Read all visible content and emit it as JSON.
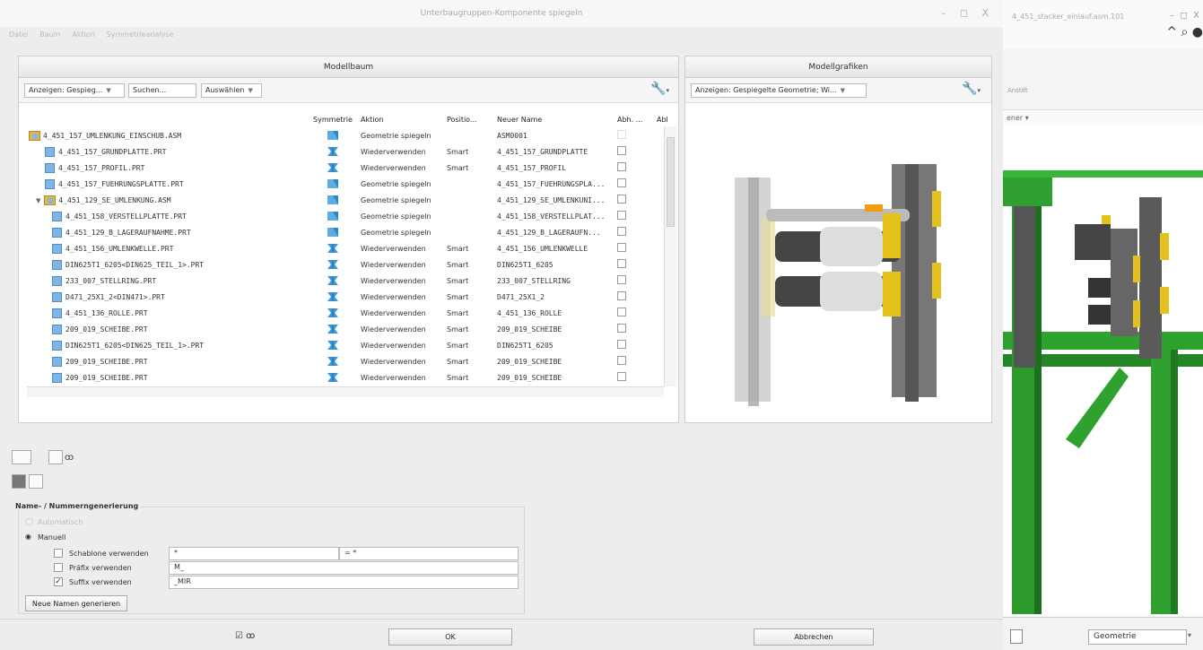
{
  "dialog": {
    "title": "Unterbaugruppen-Komponente spiegeln",
    "window_controls": "– ◻ X",
    "menu": [
      "Datei",
      "Baum",
      "Aktion",
      "Symmetrieanalyse"
    ]
  },
  "modellbaum": {
    "title": "Modellbaum",
    "show_combo": "Anzeigen: Gespieg...",
    "search_placeholder": "Suchen...",
    "select_combo": "Auswählen",
    "columns": [
      "Symmetrie",
      "Aktion",
      "Positio...",
      "Neuer Name",
      "Abh. ...",
      "Abl"
    ],
    "rows": [
      {
        "name": "4_451_157_UMLENKUNG_EINSCHUB.ASM",
        "type": "asm",
        "indent": 0,
        "action": "Geometrie spiegeln",
        "position": "",
        "new_name": "ASM0001",
        "sym": "mirror",
        "cb": "disabled"
      },
      {
        "name": "4_451_157_GRUNDPLATTE.PRT",
        "type": "prt",
        "indent": 1,
        "action": "Wiederverwenden",
        "position": "Smart",
        "new_name": "4_451_157_GRUNDPLATTE",
        "sym": "reuse",
        "cb": "on"
      },
      {
        "name": "4_451_157_PROFIL.PRT",
        "type": "prt",
        "indent": 1,
        "action": "Wiederverwenden",
        "position": "Smart",
        "new_name": "4_451_157_PROFIL",
        "sym": "reuse",
        "cb": "on"
      },
      {
        "name": "4_451_157_FUEHRUNGSPLATTE.PRT",
        "type": "prt",
        "indent": 1,
        "action": "Geometrie spiegeln",
        "position": "",
        "new_name": "4_451_157_FUEHRUNGSPLA...",
        "sym": "mirror",
        "cb": "on"
      },
      {
        "name": "4_451_129_SE_UMLENKUNG.ASM",
        "type": "asm",
        "indent": 1,
        "expand": "▼",
        "action": "Geometrie spiegeln",
        "position": "",
        "new_name": "4_451_129_SE_UMLENKUNI...",
        "sym": "mirror",
        "cb": "on"
      },
      {
        "name": "4_451_158_VERSTELLPLATTE.PRT",
        "type": "prt",
        "indent": 2,
        "action": "Geometrie spiegeln",
        "position": "",
        "new_name": "4_451_158_VERSTELLPLAT...",
        "sym": "mirror",
        "cb": "on"
      },
      {
        "name": "4_451_129_B_LAGERAUFNAHME.PRT",
        "type": "prt",
        "indent": 2,
        "action": "Geometrie spiegeln",
        "position": "",
        "new_name": "4_451_129_B_LAGERAUFN...",
        "sym": "mirror",
        "cb": "on"
      },
      {
        "name": "4_451_156_UMLENKWELLE.PRT",
        "type": "prt",
        "indent": 2,
        "action": "Wiederverwenden",
        "position": "Smart",
        "new_name": "4_451_156_UMLENKWELLE",
        "sym": "reuse",
        "cb": "on"
      },
      {
        "name": "DIN625T1_6205<DIN625_TEIL_1>.PRT",
        "type": "prt",
        "indent": 2,
        "action": "Wiederverwenden",
        "position": "Smart",
        "new_name": "DIN625T1_6205",
        "sym": "reuse",
        "cb": "on"
      },
      {
        "name": "233_007_STELLRING.PRT",
        "type": "prt",
        "indent": 2,
        "action": "Wiederverwenden",
        "position": "Smart",
        "new_name": "233_007_STELLRING",
        "sym": "reuse",
        "cb": "on"
      },
      {
        "name": "D471_25X1_2<DIN471>.PRT",
        "type": "prt",
        "indent": 2,
        "action": "Wiederverwenden",
        "position": "Smart",
        "new_name": "D471_25X1_2",
        "sym": "reuse",
        "cb": "on"
      },
      {
        "name": "4_451_136_ROLLE.PRT",
        "type": "prt",
        "indent": 2,
        "action": "Wiederverwenden",
        "position": "Smart",
        "new_name": "4_451_136_ROLLE",
        "sym": "reuse",
        "cb": "on"
      },
      {
        "name": "209_019_SCHEIBE.PRT",
        "type": "prt",
        "indent": 2,
        "action": "Wiederverwenden",
        "position": "Smart",
        "new_name": "209_019_SCHEIBE",
        "sym": "reuse",
        "cb": "on"
      },
      {
        "name": "DIN625T1_6205<DIN625_TEIL_1>.PRT",
        "type": "prt",
        "indent": 2,
        "action": "Wiederverwenden",
        "position": "Smart",
        "new_name": "DIN625T1_6205",
        "sym": "reuse",
        "cb": "on"
      },
      {
        "name": "209_019_SCHEIBE.PRT",
        "type": "prt",
        "indent": 2,
        "action": "Wiederverwenden",
        "position": "Smart",
        "new_name": "209_019_SCHEIBE",
        "sym": "reuse",
        "cb": "on"
      },
      {
        "name": "209_019_SCHEIBE.PRT",
        "type": "prt",
        "indent": 2,
        "action": "Wiederverwenden",
        "position": "Smart",
        "new_name": "209_019_SCHEIBE",
        "sym": "reuse",
        "cb": "on"
      }
    ]
  },
  "modellgrafiken": {
    "title": "Modellgrafiken",
    "show_combo": "Anzeigen: Gespiegelte Geometrie; Wi..."
  },
  "naming": {
    "group_title": "Name- / Nummerngenerierung",
    "auto_label": "Automatisch",
    "manual_label": "Manuell",
    "template_label": "Schablone verwenden",
    "template_value": "*",
    "template_eq": "= *",
    "prefix_label": "Präfix verwenden",
    "prefix_value": "M_",
    "suffix_label": "Suffix verwenden",
    "suffix_value": "_MIR",
    "generate_button": "Neue Namen generieren"
  },
  "footer": {
    "ok": "OK",
    "cancel": "Abbrechen",
    "glasses_icon": "glasses-icon"
  },
  "background_app": {
    "title": "4_451_stacker_einlauf.asm.101",
    "ribbon_text": "Anstift",
    "ribbon_dropdown": "ener ▾",
    "status_combo": "Geometrie"
  },
  "colors": {
    "mirror_icon": "#4a9ed6",
    "reuse_icon": "#2a7fc0",
    "frame_green": "#2ea12e",
    "accent_yellow": "#e2c21b"
  }
}
